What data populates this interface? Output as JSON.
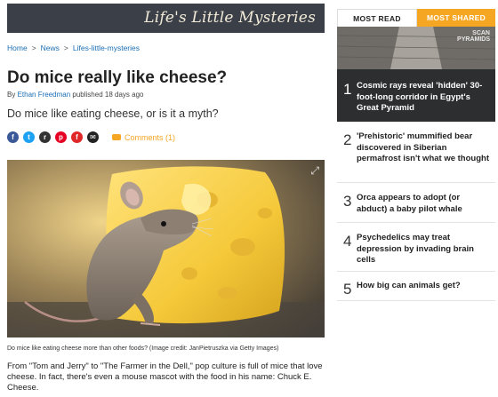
{
  "banner": {
    "title": "Life's Little Mysteries"
  },
  "breadcrumb": {
    "items": [
      "Home",
      "News",
      "Lifes-little-mysteries"
    ],
    "separator": ">"
  },
  "article": {
    "headline": "Do mice really like cheese?",
    "byline_prefix": "By",
    "author": "Ethan Freedman",
    "published": "published 18 days ago",
    "standfirst": "Do mice like eating cheese, or is it a myth?",
    "image_caption": "Do mice like eating cheese more than other foods? (Image credit: JanPietruszka via Getty Images)",
    "first_paragraph": "From \"Tom and Jerry\" to \"The Farmer in the Dell,\" pop culture is full of mice that love cheese. In fact, there's even a mouse mascot with the food in his name: Chuck E. Cheese."
  },
  "share": {
    "icons": [
      {
        "name": "facebook-icon",
        "glyph": "f",
        "color": "#3b5998"
      },
      {
        "name": "twitter-icon",
        "glyph": "t",
        "color": "#1da1f2"
      },
      {
        "name": "reddit-icon",
        "glyph": "r",
        "color": "#333333"
      },
      {
        "name": "pinterest-icon",
        "glyph": "p",
        "color": "#e60023"
      },
      {
        "name": "flipboard-icon",
        "glyph": "f",
        "color": "#e12828"
      },
      {
        "name": "email-icon",
        "glyph": "✉",
        "color": "#222222"
      }
    ],
    "comments_label": "Comments (1)"
  },
  "sidebar": {
    "tabs": [
      "MOST READ",
      "MOST SHARED"
    ],
    "most_read": [
      {
        "rank": "1",
        "title": "Cosmic rays reveal 'hidden' 30-foot-long corridor in Egypt's Great Pyramid"
      },
      {
        "rank": "2",
        "title": "'Prehistoric' mummified bear discovered in Siberian permafrost isn't what we thought"
      },
      {
        "rank": "3",
        "title": "Orca appears to adopt (or abduct) a baby pilot whale"
      },
      {
        "rank": "4",
        "title": "Psychedelics may treat depression by invading brain cells"
      },
      {
        "rank": "5",
        "title": "How big can animals get?"
      }
    ],
    "feature_watermark": "SCAN\nPYRAMIDS"
  },
  "colors": {
    "accent": "#f5a623",
    "link": "#1b6fb5",
    "banner_bg": "#3b4048",
    "feature_bg": "#2d2e30"
  }
}
